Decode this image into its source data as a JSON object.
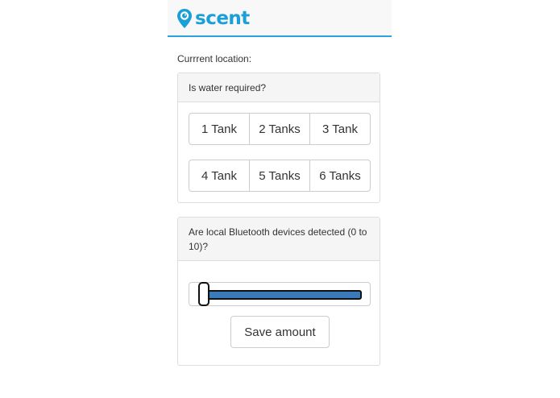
{
  "brand": {
    "name": "scent",
    "color": "#1a9fd6",
    "logo_icon": "location-pin-icon"
  },
  "location": {
    "label": "Currrent location:"
  },
  "water_panel": {
    "question": "Is water required?",
    "options": [
      "1 Tank",
      "2 Tanks",
      "3 Tank",
      "4 Tank",
      "5 Tanks",
      "6 Tanks"
    ]
  },
  "bluetooth_panel": {
    "question": "Are local Bluetooth devices detected (0 to 10)?",
    "slider": {
      "min": 0,
      "max": 10,
      "value": 0,
      "fill_color": "#3a7ab8"
    },
    "save_label": "Save amount"
  }
}
